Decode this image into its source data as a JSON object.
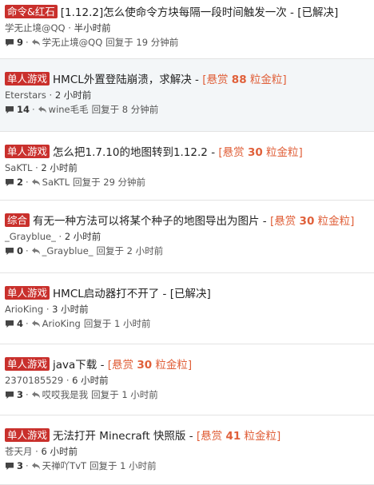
{
  "topics": [
    {
      "tag": "命令&红石",
      "title": "[1.12.2]怎么使命令方块每隔一段时间触发一次",
      "status": "[已解决]",
      "reward_prefix": "",
      "reward_amount": "",
      "reward_suffix": "",
      "author": "学无止境@QQ",
      "posted": "半小时前",
      "replies": "9",
      "last_replier": "学无止境@QQ",
      "replied_ago": "回复于 19 分钟前",
      "highlight": false
    },
    {
      "tag": "单人游戏",
      "title": "HMCL外置登陆崩溃，求解决",
      "status": "",
      "reward_prefix": "[悬赏 ",
      "reward_amount": "88",
      "reward_suffix": " 粒金粒]",
      "author": "Eterstars",
      "posted": "2 小时前",
      "replies": "14",
      "last_replier": "wine毛毛",
      "replied_ago": "回复于 8 分钟前",
      "highlight": true
    },
    {
      "tag": "单人游戏",
      "title": "怎么把1.7.10的地图转到1.12.2",
      "status": "",
      "reward_prefix": "[悬赏 ",
      "reward_amount": "30",
      "reward_suffix": " 粒金粒]",
      "author": "SaKTL",
      "posted": "2 小时前",
      "replies": "2",
      "last_replier": "SaKTL",
      "replied_ago": "回复于 29 分钟前",
      "highlight": false
    },
    {
      "tag": "综合",
      "title": "有无一种方法可以将某个种子的地图导出为图片",
      "status": "",
      "reward_prefix": "[悬赏 ",
      "reward_amount": "30",
      "reward_suffix": " 粒金粒]",
      "author": "_Grayblue_",
      "posted": "2 小时前",
      "replies": "0",
      "last_replier": "_Grayblue_",
      "replied_ago": "回复于 2 小时前",
      "highlight": false
    },
    {
      "tag": "单人游戏",
      "title": "HMCL启动器打不开了",
      "status": "[已解决]",
      "reward_prefix": "",
      "reward_amount": "",
      "reward_suffix": "",
      "author": "ArioKing",
      "posted": "3 小时前",
      "replies": "4",
      "last_replier": "ArioKing",
      "replied_ago": "回复于 1 小时前",
      "highlight": false
    },
    {
      "tag": "单人游戏",
      "title": "java下载",
      "status": "",
      "reward_prefix": "[悬赏 ",
      "reward_amount": "30",
      "reward_suffix": " 粒金粒]",
      "author": "2370185529",
      "posted": "6 小时前",
      "replies": "3",
      "last_replier": "哎哎我是我",
      "replied_ago": "回复于 1 小时前",
      "highlight": false
    },
    {
      "tag": "单人游戏",
      "title": "无法打开 Minecraft 快照版",
      "status": "",
      "reward_prefix": "[悬赏 ",
      "reward_amount": "41",
      "reward_suffix": " 粒金粒]",
      "author": "苍天月",
      "posted": "6 小时前",
      "replies": "3",
      "last_replier": "天禅吖TvT",
      "replied_ago": "回复于 1 小时前",
      "highlight": false
    }
  ],
  "separator": " - ",
  "dot": "·",
  "colors": {
    "tag_bg": "#c9302c",
    "reward": "#e0603a",
    "highlight_bg": "#f3f6f8"
  }
}
